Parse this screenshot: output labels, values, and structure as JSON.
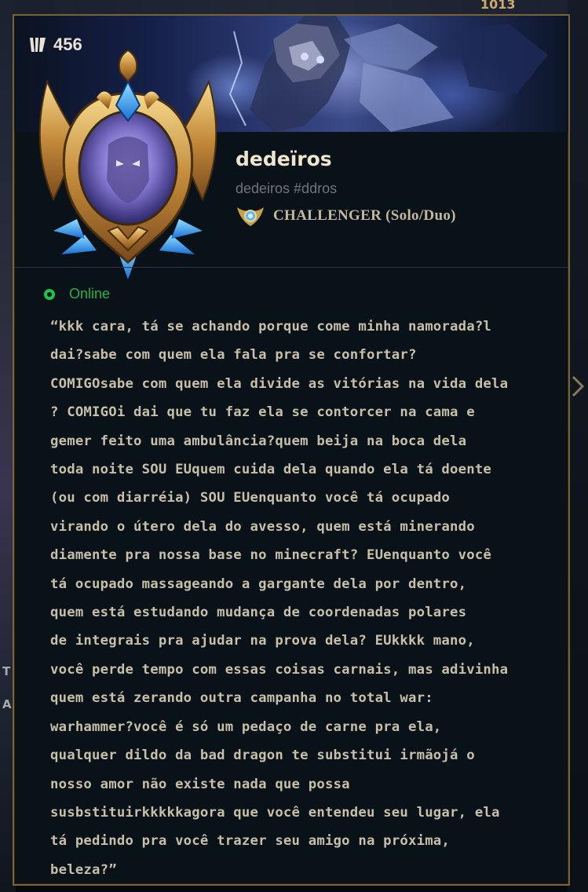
{
  "background": {
    "top_right_value": "1013",
    "left_letters": [
      "T",
      "A"
    ]
  },
  "profile": {
    "level": "456",
    "summoner_name": "dedeïros",
    "riot_id": "dedeiros #ddros",
    "rank": "CHALLENGER (Solo/Duo)",
    "status": "Online",
    "status_color": "#1ec14a",
    "accent_color": "#7a6334",
    "bio_lines": [
      "“kkk cara, tá se achando porque come minha namorada?l",
      "dai?sabe com quem ela fala pra se confortar?",
      "COMIGOsabe com quem ela divide as vitórias na vida dela",
      "? COMIGOi dai que tu faz ela se contorcer na cama e",
      "gemer feito uma ambulância?quem beija na boca dela",
      "toda noite SOU EUquem cuida dela quando ela tá doente",
      "(ou com diarréia) SOU EUenquanto você tá ocupado",
      "virando o útero dela do avesso, quem está minerando",
      "diamente pra nossa base no minecraft? EUenquanto você",
      "tá ocupado massageando a gargante dela por dentro,",
      "quem está estudando mudança de coordenadas polares",
      "de integrais pra ajudar na prova dela? EUkkkk mano,",
      "você perde tempo com essas coisas carnais, mas adivinha",
      "quem está zerando outra campanha no total war:",
      "warhammer?você é só um pedaço de carne pra ela,",
      "qualquer dildo da bad dragon te substitui irmãojá o",
      "nosso amor não existe nada que possa",
      "susbstituirkkkkkagora que você entendeu seu lugar, ela",
      "tá pedindo pra você trazer seu amigo na próxima,",
      "beleza?”"
    ]
  },
  "icons": {
    "level": "level-icon",
    "rank": "challenger-crest-icon",
    "emblem": "challenger-emblem",
    "status": "online-dot-icon",
    "chevron": "chevron-right-icon"
  }
}
